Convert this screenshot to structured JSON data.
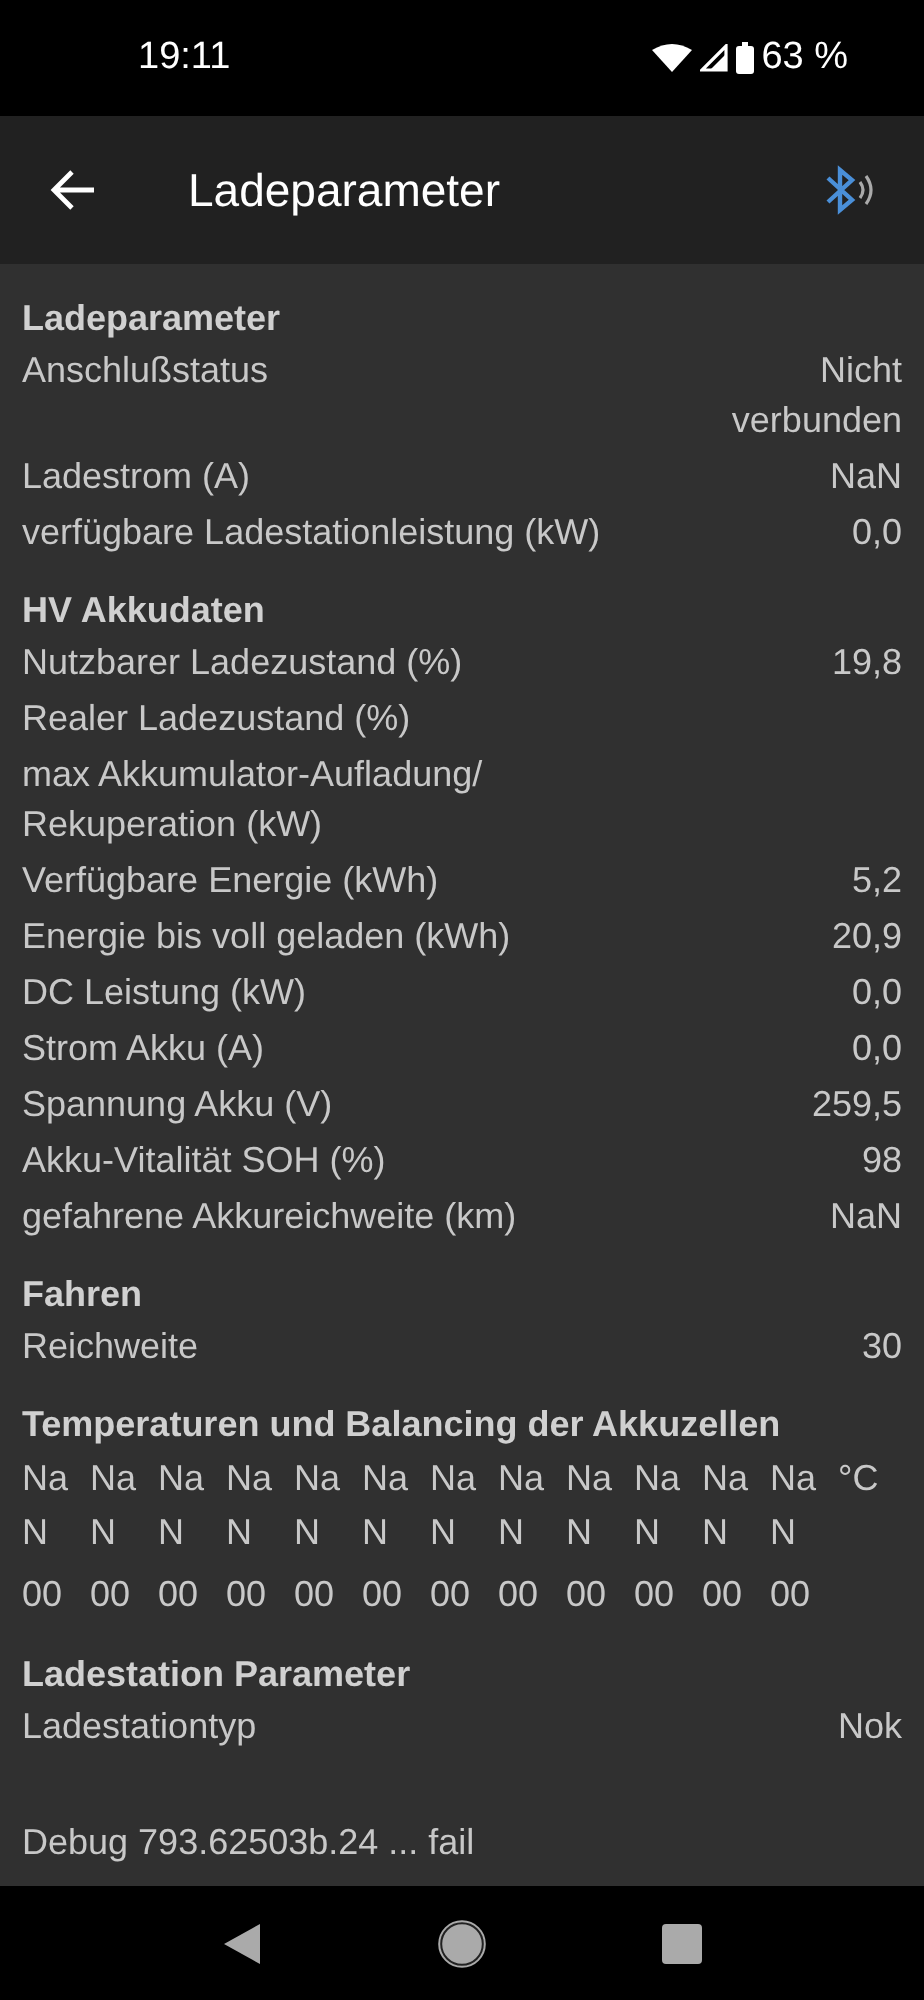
{
  "status_bar": {
    "time": "19:11",
    "battery": "63 %"
  },
  "app_bar": {
    "title": "Ladeparameter"
  },
  "sections": [
    {
      "title": "Ladeparameter",
      "rows": [
        {
          "label": "Anschlußstatus",
          "value": "Nicht verbunden"
        },
        {
          "label": "Ladestrom (A)",
          "value": "NaN"
        },
        {
          "label": "verfügbare Ladestationleistung (kW)",
          "value": "0,0"
        }
      ]
    },
    {
      "title": "HV Akkudaten",
      "rows": [
        {
          "label": "Nutzbarer Ladezustand (%)",
          "value": "19,8"
        },
        {
          "label": "Realer Ladezustand (%)"
        },
        {
          "label": "max Akkumulator-Aufladung/ Rekuperation (kW)"
        },
        {
          "label": "Verfügbare Energie (kWh)",
          "value": "5,2"
        },
        {
          "label": "Energie bis voll geladen (kWh)",
          "value": "20,9"
        },
        {
          "label": "DC Leistung (kW)",
          "value": "0,0"
        },
        {
          "label": "Strom Akku (A)",
          "value": "0,0"
        },
        {
          "label": "Spannung Akku (V)",
          "value": "259,5"
        },
        {
          "label": "Akku-Vitalität SOH (%)",
          "value": "98"
        },
        {
          "label": "gefahrene Akkureichweite (km)",
          "value": "NaN"
        }
      ]
    },
    {
      "title": "Fahren",
      "rows": [
        {
          "label": "Reichweite",
          "value": "30"
        }
      ]
    }
  ],
  "cells": {
    "title": "Temperaturen und Balancing der Akkuzellen",
    "unit": "°C",
    "items": [
      {
        "temp": [
          "Na",
          "N"
        ],
        "balance": "00"
      },
      {
        "temp": [
          "Na",
          "N"
        ],
        "balance": "00"
      },
      {
        "temp": [
          "Na",
          "N"
        ],
        "balance": "00"
      },
      {
        "temp": [
          "Na",
          "N"
        ],
        "balance": "00"
      },
      {
        "temp": [
          "Na",
          "N"
        ],
        "balance": "00"
      },
      {
        "temp": [
          "Na",
          "N"
        ],
        "balance": "00"
      },
      {
        "temp": [
          "Na",
          "N"
        ],
        "balance": "00"
      },
      {
        "temp": [
          "Na",
          "N"
        ],
        "balance": "00"
      },
      {
        "temp": [
          "Na",
          "N"
        ],
        "balance": "00"
      },
      {
        "temp": [
          "Na",
          "N"
        ],
        "balance": "00"
      },
      {
        "temp": [
          "Na",
          "N"
        ],
        "balance": "00"
      },
      {
        "temp": [
          "Na",
          "N"
        ],
        "balance": "00"
      }
    ]
  },
  "station": {
    "title": "Ladestation Parameter",
    "rows": [
      {
        "label": "Ladestationtyp",
        "value": "Nok"
      }
    ]
  },
  "debug": "Debug 793.62503b.24 ... fail"
}
